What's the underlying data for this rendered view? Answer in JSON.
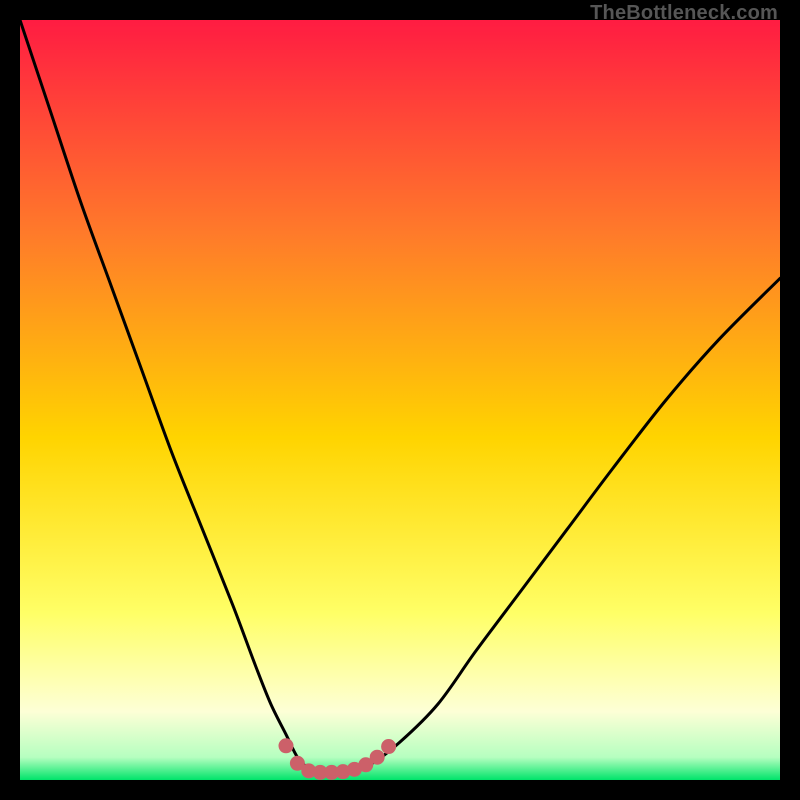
{
  "watermark": "TheBottleneck.com",
  "colors": {
    "frame": "#000000",
    "gradient_top": "#ff1c42",
    "gradient_mid_upper": "#ff7a2a",
    "gradient_mid": "#ffd400",
    "gradient_mid_lower": "#ffff66",
    "gradient_pale": "#fdffd6",
    "gradient_green": "#00e46a",
    "curve": "#000000",
    "markers": "#cc6069"
  },
  "chart_data": {
    "type": "line",
    "title": "",
    "xlabel": "",
    "ylabel": "",
    "xlim": [
      0,
      100
    ],
    "ylim": [
      0,
      100
    ],
    "series": [
      {
        "name": "bottleneck-curve",
        "x": [
          0,
          4,
          8,
          12,
          16,
          20,
          24,
          28,
          31,
          33,
          35,
          36.5,
          38,
          39.5,
          41,
          43,
          46,
          50,
          55,
          60,
          66,
          72,
          78,
          85,
          92,
          100
        ],
        "y": [
          100,
          88,
          76,
          65,
          54,
          43,
          33,
          23,
          15,
          10,
          6,
          3,
          1.5,
          1,
          1,
          1.2,
          2,
          5,
          10,
          17,
          25,
          33,
          41,
          50,
          58,
          66
        ]
      }
    ],
    "markers": {
      "name": "highlight-dots",
      "x": [
        35,
        36.5,
        38,
        39.5,
        41,
        42.5,
        44,
        45.5,
        47,
        48.5
      ],
      "y": [
        4.5,
        2.2,
        1.2,
        1,
        1,
        1.1,
        1.4,
        2.0,
        3.0,
        4.4
      ]
    }
  }
}
